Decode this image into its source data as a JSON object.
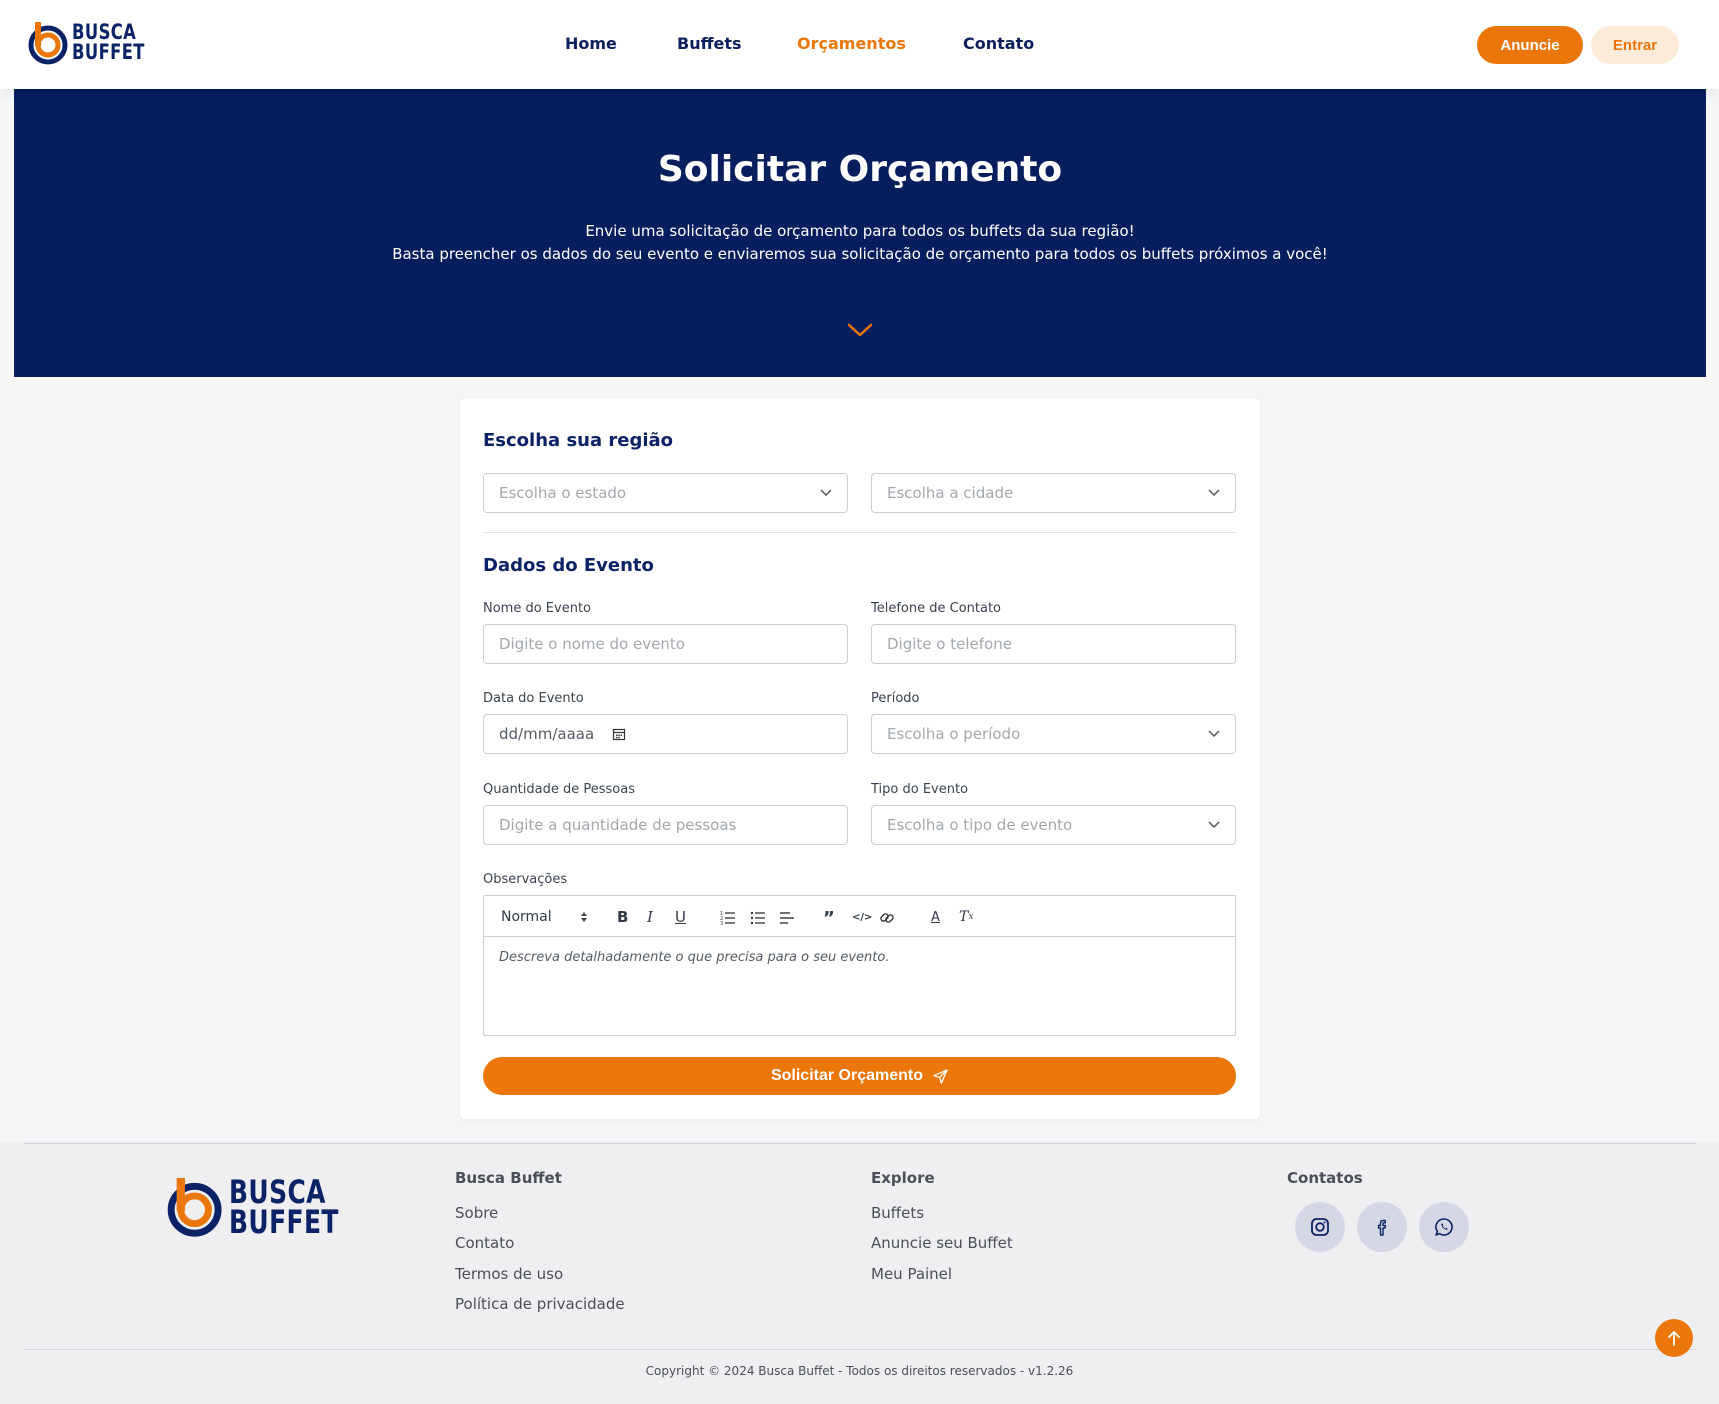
{
  "brand": {
    "logo_line1": "BUSCA",
    "logo_line2": "BUFFET"
  },
  "colors": {
    "accent": "#eb7609",
    "navy": "#061e5e"
  },
  "nav": {
    "items": [
      {
        "label": "Home",
        "active": false
      },
      {
        "label": "Buffets",
        "active": false
      },
      {
        "label": "Orçamentos",
        "active": true
      },
      {
        "label": "Contato",
        "active": false
      }
    ],
    "anuncie_label": "Anuncie",
    "entrar_label": "Entrar"
  },
  "hero": {
    "title": "Solicitar Orçamento",
    "line1": "Envie uma solicitação de orçamento para todos os buffets da sua região!",
    "line2": "Basta preencher os dados do seu evento e enviaremos sua solicitação de orçamento para todos os buffets próximos a você!",
    "scroll_icon": "chevron-down-icon"
  },
  "form": {
    "region_title": "Escolha sua região",
    "state_placeholder": "Escolha o estado",
    "city_placeholder": "Escolha a cidade",
    "event_title": "Dados do Evento",
    "event_name_label": "Nome do Evento",
    "event_name_placeholder": "Digite o nome do evento",
    "phone_label": "Telefone de Contato",
    "phone_placeholder": "Digite o telefone",
    "date_label": "Data do Evento",
    "date_placeholder": "dd/mm/aaaa",
    "period_label": "Período",
    "period_placeholder": "Escolha o período",
    "people_label": "Quantidade de Pessoas",
    "people_placeholder": "Digite a quantidade de pessoas",
    "type_label": "Tipo do Evento",
    "type_placeholder": "Escolha o tipo de evento",
    "notes_label": "Observações",
    "editor_format": "Normal",
    "editor_placeholder": "Descreva detalhadamente o que precisa para o seu evento.",
    "submit_label": "Solicitar Orçamento"
  },
  "footer": {
    "col1": {
      "title": "Busca Buffet",
      "links": [
        "Sobre",
        "Contato",
        "Termos de uso",
        "Política de privacidade"
      ]
    },
    "col2": {
      "title": "Explore",
      "links": [
        "Buffets",
        "Anuncie seu Buffet",
        "Meu Painel"
      ]
    },
    "col3": {
      "title": "Contatos",
      "socials": [
        "instagram-icon",
        "facebook-icon",
        "whatsapp-icon"
      ]
    },
    "copyright": "Copyright © 2024 Busca Buffet - Todos os direitos reservados - v1.2.26"
  }
}
